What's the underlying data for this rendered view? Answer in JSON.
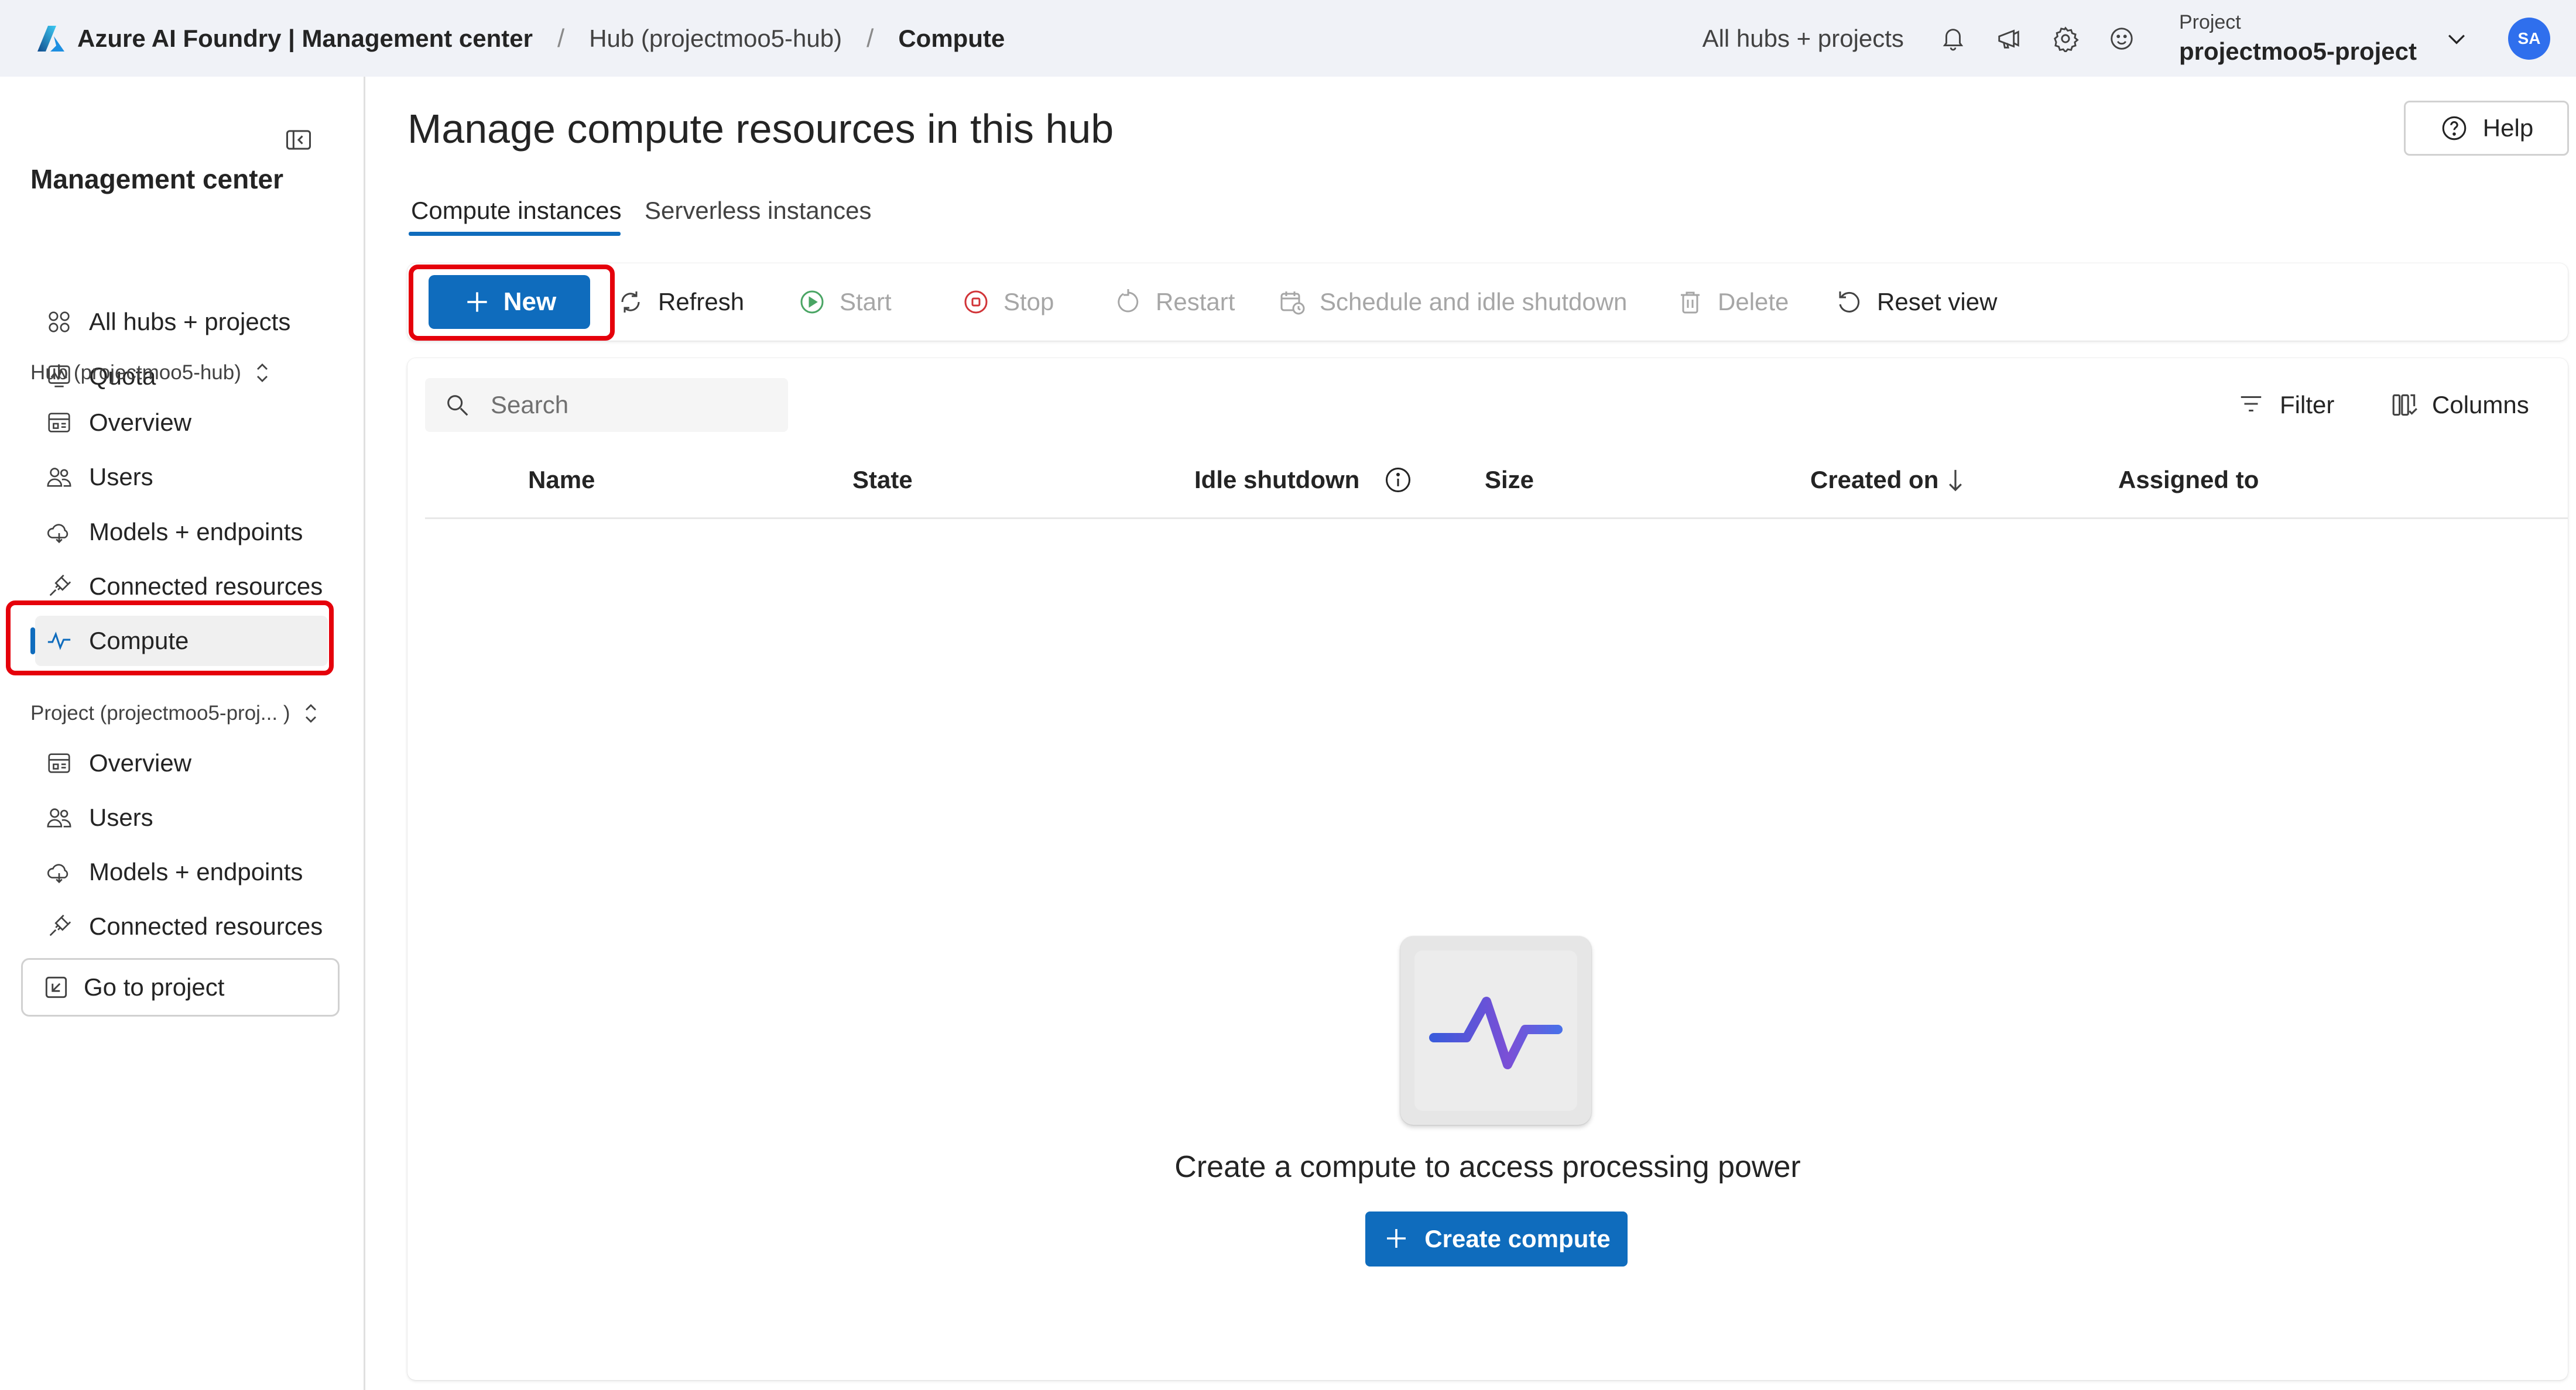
{
  "topbar": {
    "brand": "Azure AI Foundry | Management center",
    "breadcrumbs": [
      "Hub (projectmoo5-hub)",
      "Compute"
    ],
    "separator": "/",
    "all_hubs_link": "All hubs + projects",
    "icons": [
      "bell-icon",
      "megaphone-icon",
      "gear-icon",
      "smiley-icon"
    ],
    "project_caption": "Project",
    "project_name": "projectmoo5-project",
    "avatar_initials": "SA"
  },
  "sidebar": {
    "title": "Management center",
    "top_items": [
      {
        "label": "All hubs + projects",
        "icon": "grid-icon"
      },
      {
        "label": "Quota",
        "icon": "quota-icon"
      }
    ],
    "hub_section": "Hub (projectmoo5-hub)",
    "hub_items": [
      {
        "label": "Overview",
        "icon": "overview-icon"
      },
      {
        "label": "Users",
        "icon": "users-icon"
      },
      {
        "label": "Models + endpoints",
        "icon": "cloud-icon"
      },
      {
        "label": "Connected resources",
        "icon": "plug-icon"
      },
      {
        "label": "Compute",
        "icon": "pulse-icon",
        "active": true
      }
    ],
    "project_section": "Project (projectmoo5-proj... )",
    "project_items": [
      {
        "label": "Overview",
        "icon": "overview-icon"
      },
      {
        "label": "Users",
        "icon": "users-icon"
      },
      {
        "label": "Models + endpoints",
        "icon": "cloud-icon"
      },
      {
        "label": "Connected resources",
        "icon": "plug-icon"
      }
    ],
    "goto_project": "Go to project"
  },
  "main": {
    "title": "Manage compute resources in this hub",
    "help": "Help",
    "tabs": [
      {
        "label": "Compute instances",
        "active": true
      },
      {
        "label": "Serverless instances",
        "active": false
      }
    ],
    "toolbar": {
      "new": "New",
      "refresh": "Refresh",
      "start": "Start",
      "stop": "Stop",
      "restart": "Restart",
      "schedule": "Schedule and idle shutdown",
      "delete": "Delete",
      "reset_view": "Reset view"
    },
    "search_placeholder": "Search",
    "filter": "Filter",
    "columns_btn": "Columns",
    "columns": [
      "Name",
      "State",
      "Idle shutdown",
      "Size",
      "Created on",
      "Assigned to"
    ],
    "empty_state": {
      "message": "Create a compute to access processing power",
      "button": "Create compute"
    }
  },
  "colors": {
    "accent": "#0f6cbd",
    "highlight_outline": "#e5000b",
    "topbar_bg": "#f0f2f7"
  }
}
